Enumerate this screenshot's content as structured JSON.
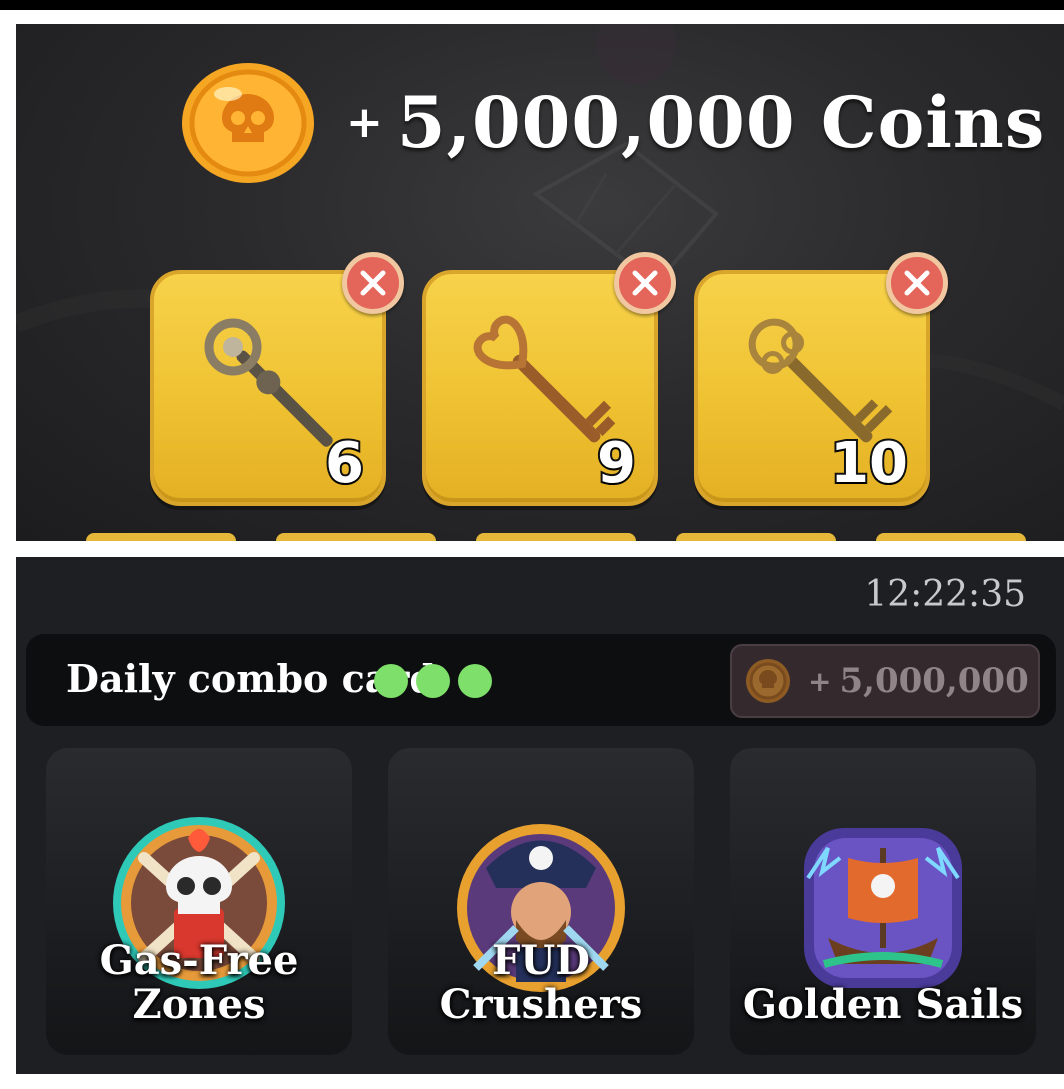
{
  "reward_header": {
    "plus": "+",
    "amount_text": "5,000,000 Coins",
    "coin_icon": "skull-coin-icon"
  },
  "keys": [
    {
      "icon": "ornate-silver-key-icon",
      "count": "6"
    },
    {
      "icon": "heart-bronze-key-icon",
      "count": "9"
    },
    {
      "icon": "filigree-gold-key-icon",
      "count": "10"
    }
  ],
  "daily_combo": {
    "timer": "12:22:35",
    "label": "Daily combo card",
    "progress_dots": 3,
    "dot_color": "#7ee06a",
    "reward_plus": "+",
    "reward_amount": "5,000,000"
  },
  "combo_cards": [
    {
      "title": "Gas-Free Zones",
      "icon": "skull-crossbones-badge-icon"
    },
    {
      "title": "FUD Crushers",
      "icon": "pirate-captain-badge-icon"
    },
    {
      "title": "Golden Sails",
      "icon": "pirate-ship-badge-icon"
    }
  ],
  "colors": {
    "card_yellow": "#efc232",
    "close_red": "#e4655a",
    "panel_dark": "#1e1f22"
  }
}
